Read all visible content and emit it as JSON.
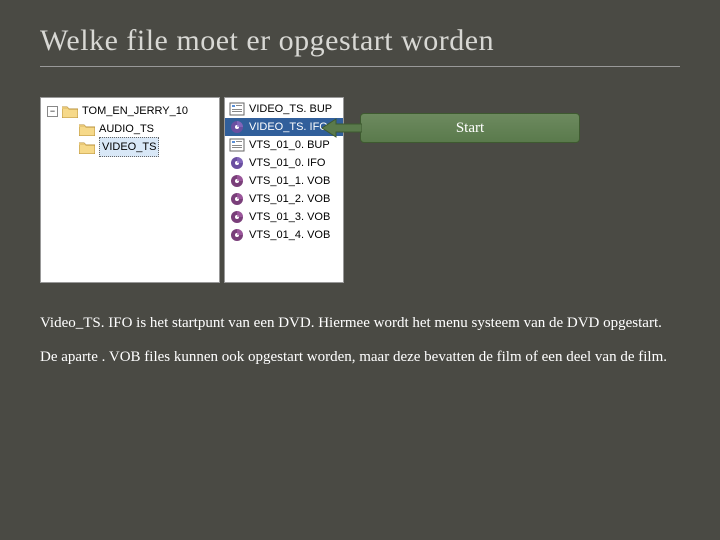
{
  "title": "Welke file moet er opgestart worden",
  "tree": {
    "root": "TOM_EN_JERRY_10",
    "children": [
      "AUDIO_TS",
      "VIDEO_TS"
    ],
    "selected": "VIDEO_TS"
  },
  "files": [
    {
      "name": "VIDEO_TS. BUP",
      "type": "bup"
    },
    {
      "name": "VIDEO_TS. IFO",
      "type": "ifo",
      "selected": true
    },
    {
      "name": "VTS_01_0. BUP",
      "type": "bup"
    },
    {
      "name": "VTS_01_0. IFO",
      "type": "ifo"
    },
    {
      "name": "VTS_01_1. VOB",
      "type": "vob"
    },
    {
      "name": "VTS_01_2. VOB",
      "type": "vob"
    },
    {
      "name": "VTS_01_3. VOB",
      "type": "vob"
    },
    {
      "name": "VTS_01_4. VOB",
      "type": "vob"
    }
  ],
  "callout": "Start",
  "para1": "Video_TS. IFO  is het startpunt van een DVD. Hiermee wordt het menu systeem van de DVD opgestart.",
  "para2": "De aparte . VOB files kunnen ook opgestart worden, maar deze bevatten de film of een deel van de film."
}
